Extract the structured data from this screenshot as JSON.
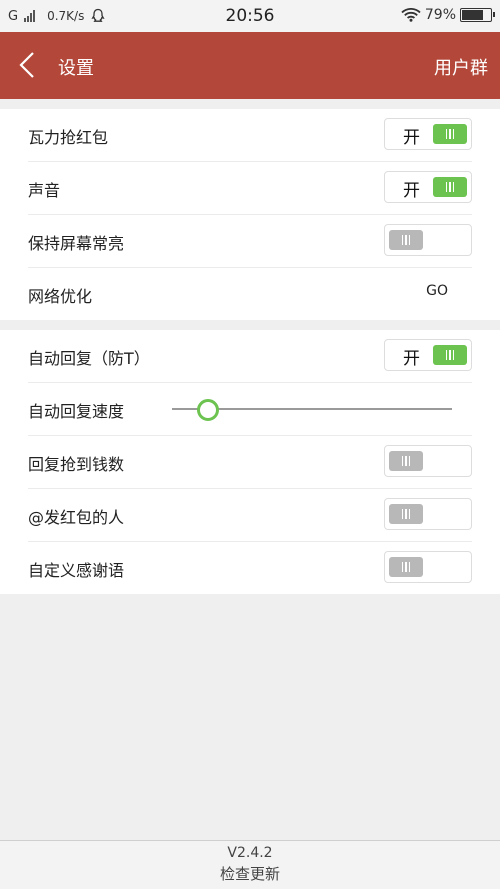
{
  "status_bar": {
    "network": "G",
    "speed": "0.7K/s",
    "time": "20:56",
    "battery_text": "79%",
    "battery_level": 0.79,
    "icons": [
      "signal-icon",
      "qq-icon",
      "wifi-icon",
      "battery-icon"
    ]
  },
  "appbar": {
    "title": "设置",
    "action": "用户群",
    "color": "#b3483a"
  },
  "section1": {
    "items": [
      {
        "label": "瓦力抢红包",
        "toggle": "on",
        "toggle_text": "开"
      },
      {
        "label": "声音",
        "toggle": "on",
        "toggle_text": "开"
      },
      {
        "label": "保持屏幕常亮",
        "toggle": "off"
      },
      {
        "label": "网络优化",
        "go": "GO"
      }
    ]
  },
  "section2": {
    "items": [
      {
        "label": "自动回复（防T）",
        "toggle": "on",
        "toggle_text": "开"
      },
      {
        "label": "自动回复速度",
        "slider_value": 0.05
      },
      {
        "label": "回复抢到钱数",
        "toggle": "off"
      },
      {
        "label": "@发红包的人",
        "toggle": "off"
      },
      {
        "label": "自定义感谢语",
        "toggle": "off"
      }
    ]
  },
  "footer": {
    "version": "V2.4.2",
    "update_label": "检查更新"
  },
  "colors": {
    "accent_green": "#6cc350",
    "toggle_off": "#b8b8b8"
  }
}
